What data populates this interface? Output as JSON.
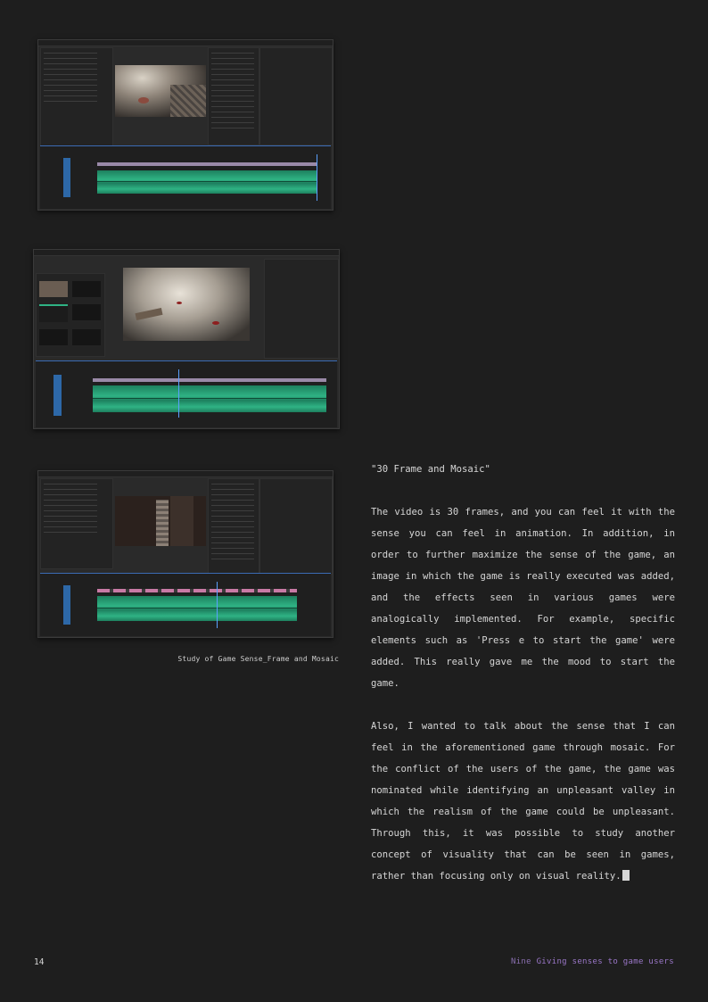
{
  "figures": [
    {
      "id": "timeline-1"
    },
    {
      "id": "timeline-2"
    },
    {
      "id": "timeline-3"
    }
  ],
  "caption": "Study of Game Sense_Frame and Mosaic",
  "section_title": "\"30 Frame and Mosaic\"",
  "paragraphs": [
    "The video is 30 frames, and you can feel it with the sense you can feel in animation. In addition, in order to further maximize the sense of the game, an image in which the game is really executed was added, and the effects seen in various games were analogically implemented. For example, specific elements such as 'Press e to start the game' were added. This really gave me the mood to start the game.",
    "Also, I wanted to talk about the sense that I can feel in the aforementioned game through mosaic. For the conflict of the users of the game, the game was nominated while identifying an unpleasant valley in which the realism of the game could be unpleasant. Through this, it was possible to study another concept of visuality that can be seen in games, rather than focusing only on visual reality."
  ],
  "page_number": "14",
  "footer": {
    "chapter": "Nine",
    "title": "Giving senses to game users"
  },
  "colors": {
    "background": "#1e1e1e",
    "waveform": "#2fb384",
    "playhead": "#5aa0ff",
    "footer": "#9b77c9"
  }
}
